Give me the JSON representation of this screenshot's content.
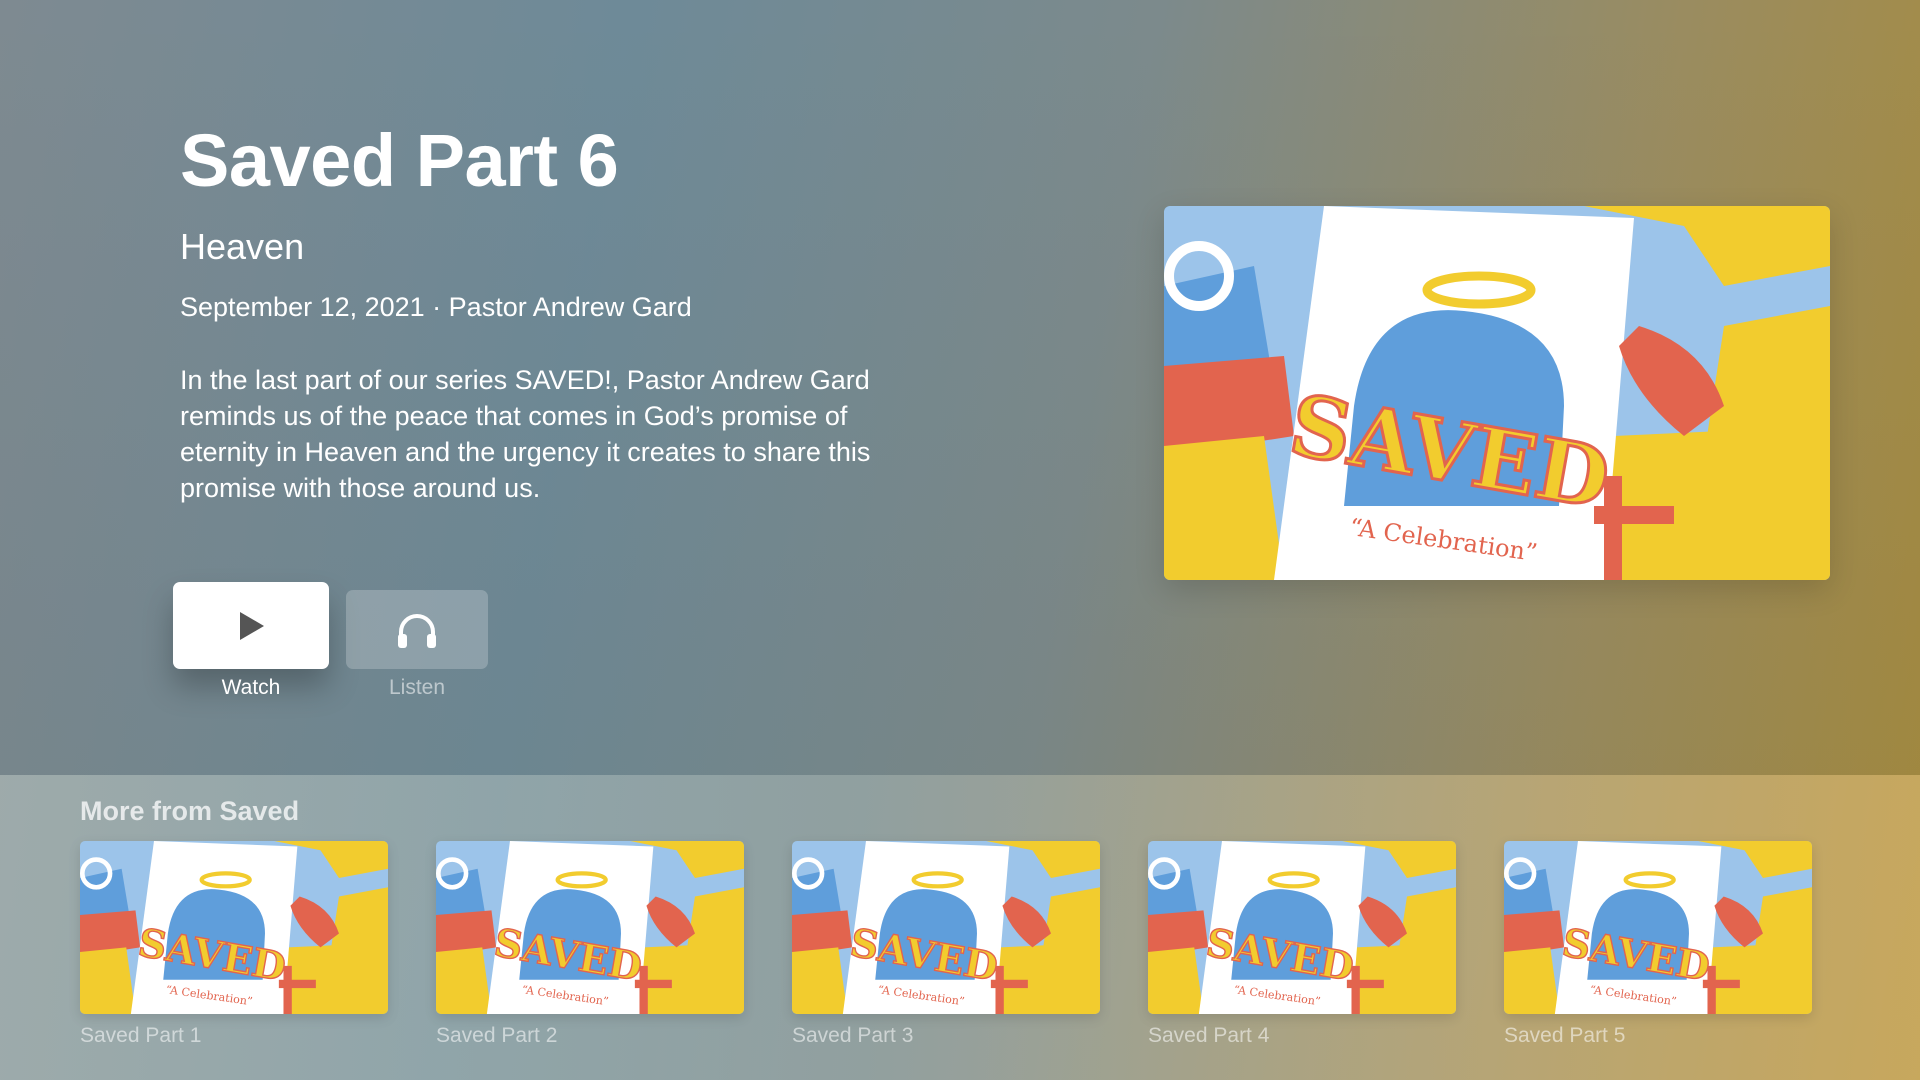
{
  "episode": {
    "title": "Saved Part 6",
    "subtitle": "Heaven",
    "meta": "September 12, 2021 · Pastor Andrew Gard",
    "description": "In the last part of our series SAVED!, Pastor Andrew Gard reminds us of the peace that comes in God’s promise of eternity in Heaven and the urgency it creates to share this promise with those around us."
  },
  "artwork": {
    "logo_text": "SAVED",
    "tagline": "“A Celebration”",
    "colors": {
      "yellow": "#f2cc2e",
      "blue": "#5f9edb",
      "light_blue": "#9cc4ea",
      "red": "#e2644e",
      "white": "#ffffff"
    }
  },
  "actions": {
    "watch": {
      "label": "Watch",
      "icon": "play-icon"
    },
    "listen": {
      "label": "Listen",
      "icon": "headphones-icon"
    }
  },
  "shelf": {
    "title": "More from Saved",
    "items": [
      {
        "label": "Saved Part 1"
      },
      {
        "label": "Saved Part 2"
      },
      {
        "label": "Saved Part 3"
      },
      {
        "label": "Saved Part 4"
      },
      {
        "label": "Saved Part 5"
      }
    ]
  }
}
